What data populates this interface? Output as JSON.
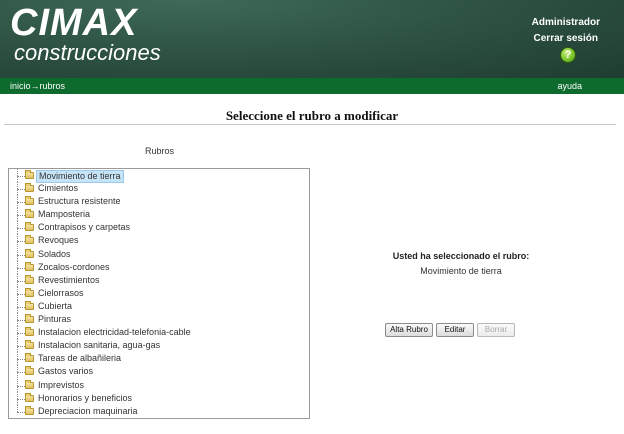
{
  "header": {
    "logo_main": "CIMAX",
    "logo_sub": "construcciones",
    "user": "Administrador",
    "logout": "Cerrar sesión",
    "help_icon": "?"
  },
  "nav": {
    "breadcrumb": "inicio→rubros",
    "help": "ayuda"
  },
  "page": {
    "title": "Seleccione el rubro a modificar",
    "tree_caption": "Rubros"
  },
  "tree": {
    "icon": "folder-icon",
    "selected_index": 0,
    "items": [
      "Movimiento de tierra",
      "Cimientos",
      "Estructura resistente",
      "Mamposteria",
      "Contrapisos y carpetas",
      "Revoques",
      "Solados",
      "Zocalos-cordones",
      "Revestimientos",
      "Cielorrasos",
      "Cubierta",
      "Pinturas",
      "Instalacion electricidad-telefonia-cable",
      "Instalacion sanitaria, agua-gas",
      "Tareas de albañileria",
      "Gastos varios",
      "Imprevistos",
      "Honorarios y beneficios",
      "Depreciacion maquinaria"
    ]
  },
  "selection": {
    "caption": "Usted ha seleccionado el rubro:",
    "value": "Movimiento de tierra"
  },
  "buttons": {
    "alta": "Alta Rubro",
    "editar": "Editar",
    "borrar": "Borrar"
  },
  "colors": {
    "header_bg": "#2b4f40",
    "nav_bg": "#0d6b2e",
    "selected_bg": "#c6e3f7"
  }
}
